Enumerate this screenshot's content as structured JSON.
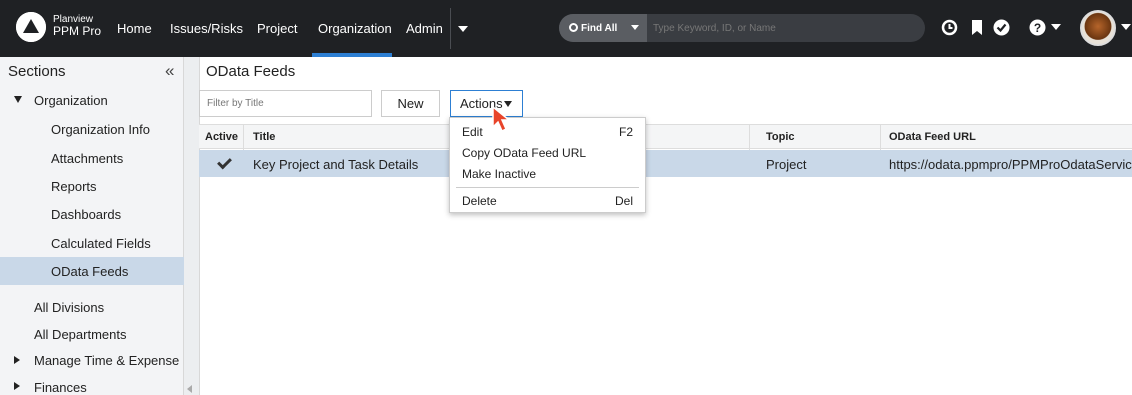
{
  "topbar": {
    "brand_line1": "Planview",
    "brand_line2": "PPM Pro",
    "nav": [
      {
        "label": "Home"
      },
      {
        "label": "Issues/Risks"
      },
      {
        "label": "Project"
      },
      {
        "label": "Organization"
      },
      {
        "label": "Admin"
      }
    ],
    "active_nav": "Organization",
    "find_all_label": "Find All",
    "search_placeholder": "Type Keyword, ID, or Name",
    "icons": [
      "clock-icon",
      "bookmark-icon",
      "check-circle-icon",
      "help-icon",
      "avatar"
    ]
  },
  "sidebar": {
    "heading": "Sections",
    "collapse_glyph": "«",
    "group_label": "Organization",
    "items": [
      {
        "label": "Organization Info"
      },
      {
        "label": "Attachments"
      },
      {
        "label": "Reports"
      },
      {
        "label": "Dashboards"
      },
      {
        "label": "Calculated Fields"
      },
      {
        "label": "OData Feeds"
      }
    ],
    "selected": "OData Feeds",
    "other_items": [
      {
        "label": "All Divisions"
      },
      {
        "label": "All Departments"
      },
      {
        "label": "Manage Time & Expense"
      },
      {
        "label": "Finances"
      }
    ]
  },
  "main": {
    "title": "OData Feeds",
    "filter_placeholder": "Filter by Title",
    "new_label": "New",
    "actions_label": "Actions",
    "columns": [
      "Active",
      "Title",
      "Topic",
      "OData Feed URL"
    ],
    "rows": [
      {
        "active": true,
        "title": "Key Project and Task Details",
        "topic": "Project",
        "url": "https://odata.ppmpro/PPMProOdataService/"
      }
    ]
  },
  "actions_menu": {
    "items": [
      {
        "label": "Edit",
        "shortcut": "F2"
      },
      {
        "label": "Copy OData Feed URL",
        "shortcut": ""
      },
      {
        "label": "Make Inactive",
        "shortcut": ""
      },
      {
        "label": "Delete",
        "shortcut": "Del"
      }
    ]
  },
  "colors": {
    "topbar": "#1f2124",
    "accent": "#2d7fd3",
    "selected_row": "#c9d8e8",
    "cursor": "#e8442a"
  }
}
